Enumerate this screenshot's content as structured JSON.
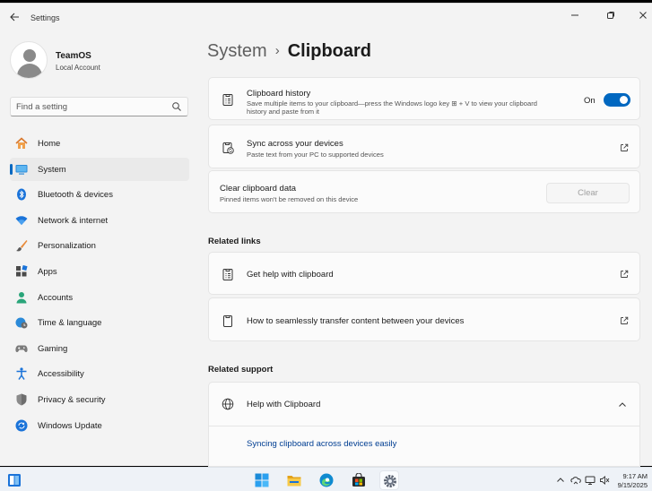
{
  "window": {
    "title": "Settings"
  },
  "profile": {
    "name": "TeamOS",
    "account_type": "Local Account"
  },
  "search": {
    "placeholder": "Find a setting"
  },
  "nav": {
    "items": [
      {
        "label": "Home",
        "icon": "home-icon"
      },
      {
        "label": "System",
        "icon": "system-icon",
        "active": true
      },
      {
        "label": "Bluetooth & devices",
        "icon": "bluetooth-icon"
      },
      {
        "label": "Network & internet",
        "icon": "wifi-icon"
      },
      {
        "label": "Personalization",
        "icon": "brush-icon"
      },
      {
        "label": "Apps",
        "icon": "apps-icon"
      },
      {
        "label": "Accounts",
        "icon": "accounts-icon"
      },
      {
        "label": "Time & language",
        "icon": "globe-clock-icon"
      },
      {
        "label": "Gaming",
        "icon": "gamepad-icon"
      },
      {
        "label": "Accessibility",
        "icon": "accessibility-icon"
      },
      {
        "label": "Privacy & security",
        "icon": "shield-icon"
      },
      {
        "label": "Windows Update",
        "icon": "update-icon"
      }
    ]
  },
  "breadcrumb": {
    "parent": "System",
    "separator": "›",
    "current": "Clipboard"
  },
  "cards": {
    "history": {
      "title": "Clipboard history",
      "description": "Save multiple items to your clipboard—press the Windows logo key ⊞ + V to view your clipboard history and paste from it",
      "toggle_state": "On"
    },
    "sync": {
      "title": "Sync across your devices",
      "description": "Paste text from your PC to supported devices"
    },
    "clear": {
      "title": "Clear clipboard data",
      "description": "Pinned items won't be removed on this device",
      "button": "Clear"
    }
  },
  "related_links": {
    "heading": "Related links",
    "items": [
      {
        "label": "Get help with clipboard"
      },
      {
        "label": "How to seamlessly transfer content between your devices"
      }
    ]
  },
  "related_support": {
    "heading": "Related support",
    "title": "Help with Clipboard",
    "link": "Syncing clipboard across devices easily"
  },
  "taskbar": {
    "time": "9:17 AM",
    "date": "9/15/2025"
  },
  "colors": {
    "accent": "#0067c0",
    "link": "#003e92",
    "background": "#f3f3f3",
    "card": "#fbfbfb"
  }
}
